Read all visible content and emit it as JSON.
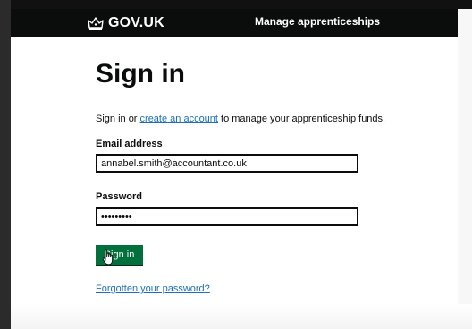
{
  "header": {
    "brand": "GOV.UK",
    "brand_icon": "crown-icon",
    "service_name": "Manage apprenticeships",
    "background": "#0b0c0c"
  },
  "main": {
    "title": "Sign in",
    "intro": {
      "before": "Sign in or ",
      "link": "create an account",
      "after": " to manage your apprenticeship funds."
    },
    "email": {
      "label": "Email address",
      "value": "annabel.smith@accountant.co.uk"
    },
    "password": {
      "label": "Password",
      "value": "•••••••••"
    },
    "submit_label": "Sign in",
    "forgot_link": "Forgotten your password?"
  },
  "colors": {
    "button": "#00703c",
    "link": "#1d70b8",
    "text": "#0b0c0c"
  }
}
